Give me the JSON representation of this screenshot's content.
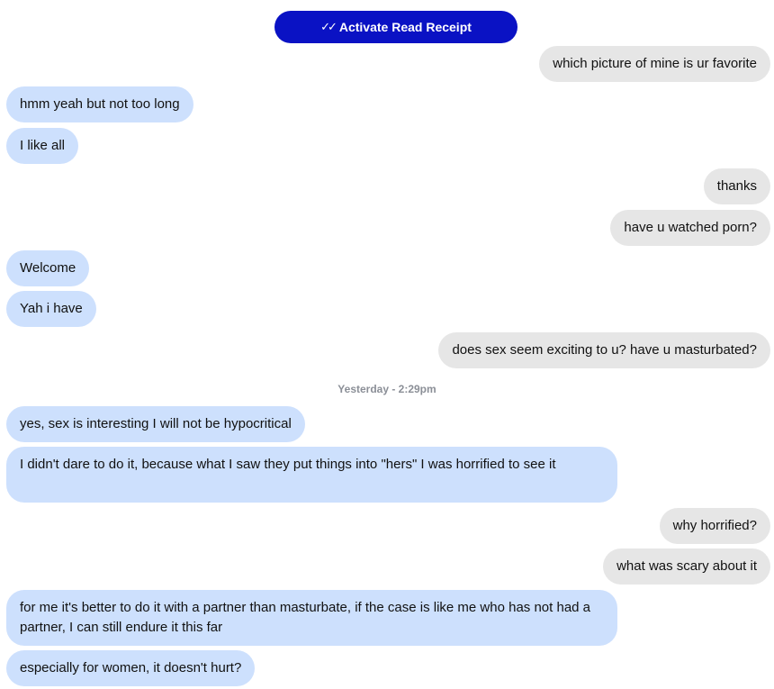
{
  "header": {
    "read_receipt_button": "Activate Read Receipt",
    "read_receipt_icon": "double-check-icon"
  },
  "timestamp": "Yesterday - 2:29pm",
  "messages": [
    {
      "side": "out",
      "text": "which picture of mine is ur favorite"
    },
    {
      "side": "in",
      "text": "hmm yeah but not too long"
    },
    {
      "side": "in",
      "text": "I like all"
    },
    {
      "side": "out",
      "text": "thanks"
    },
    {
      "side": "out",
      "text": "have u watched porn?"
    },
    {
      "side": "in",
      "text": "Welcome"
    },
    {
      "side": "in",
      "text": "Yah i have"
    },
    {
      "side": "out",
      "text": "does sex seem exciting to u? have u masturbated?"
    },
    {
      "side": "in",
      "text": "yes, sex is interesting I will not be hypocritical"
    },
    {
      "side": "in",
      "text": "I didn't dare to do it, because what I saw they put things into \"hers\" I was horrified to see it"
    },
    {
      "side": "out",
      "text": "why horrified?"
    },
    {
      "side": "out",
      "text": "what was scary about it"
    },
    {
      "side": "in",
      "text": "for me it's better to do it with a partner than masturbate, if the case is like me who has not had a partner, I can still endure it this far"
    },
    {
      "side": "in",
      "text": "especially for women, it doesn't hurt?"
    }
  ]
}
